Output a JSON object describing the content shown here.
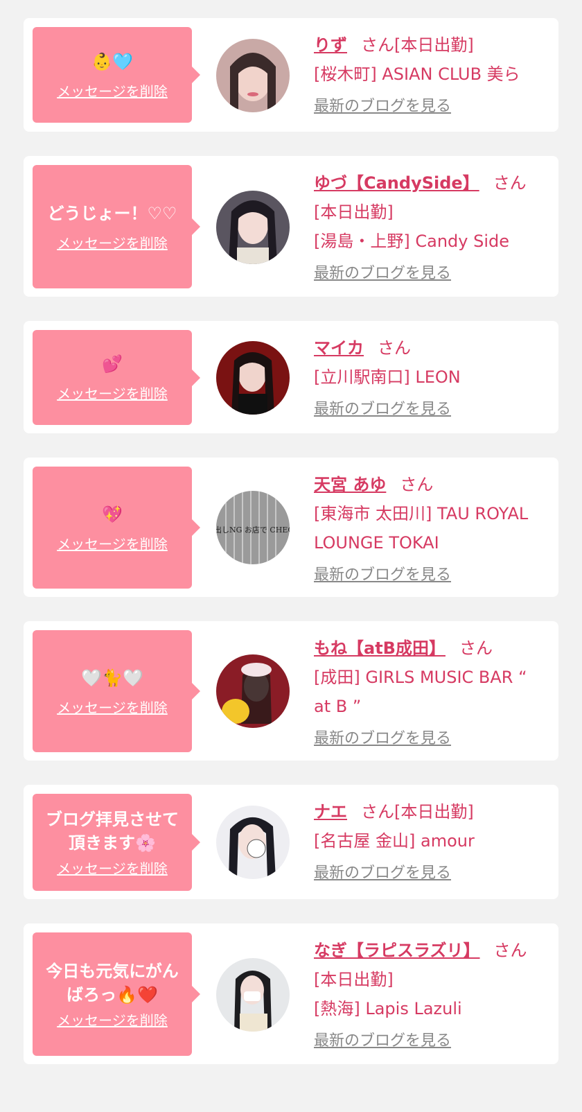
{
  "colors": {
    "background": "#f2f2f2",
    "card": "#ffffff",
    "bubble": "#fd8fa0",
    "accent": "#d63a62",
    "blog_link": "#888888"
  },
  "delete_label": "メッセージを削除",
  "san_label": "さん",
  "blog_label": "最新のブログを見る",
  "items": [
    {
      "message": "👶🩵",
      "name": "りず",
      "status": "[本日出勤]",
      "shop": "[桜木町] ASIAN CLUB 美ら"
    },
    {
      "message": "どうじょー！♡♡",
      "name": "ゆづ【CandySide】",
      "status": "[本日出勤]",
      "shop": "[湯島・上野] Candy Side"
    },
    {
      "message": "💕",
      "name": "マイカ",
      "status": "",
      "shop": "[立川駅南口] LEON"
    },
    {
      "message": "💖",
      "name": "天宮 あゆ",
      "status": "",
      "shop": "[東海市 太田川] TAU ROYAL LOUNGE TOKAI",
      "avatar_text": "顔出しNG お店で CHECK"
    },
    {
      "message": "🤍🐈🤍",
      "name": "もね【atB成田】",
      "status": "",
      "shop": "[成田] GIRLS MUSIC BAR “ at B ”"
    },
    {
      "message": "ブログ拝見させて頂きます🌸",
      "name": "ナエ",
      "status": "[本日出勤]",
      "shop": "[名古屋 金山] amour"
    },
    {
      "message": "今日も元気にがんばろっ🔥❤️",
      "name": "なぎ【ラピスラズリ】",
      "status": "[本日出勤]",
      "shop": "[熱海] Lapis Lazuli"
    }
  ]
}
